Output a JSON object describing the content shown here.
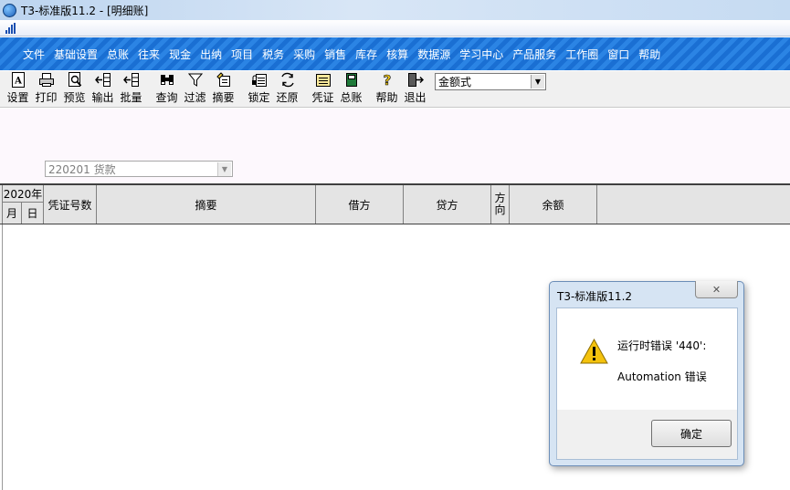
{
  "window": {
    "title": "T3-标准版11.2 - [明细账]"
  },
  "menu": [
    "文件",
    "基础设置",
    "总账",
    "往来",
    "现金",
    "出纳",
    "项目",
    "税务",
    "采购",
    "销售",
    "库存",
    "核算",
    "数据源",
    "学习中心",
    "产品服务",
    "工作圈",
    "窗口",
    "帮助"
  ],
  "toolbar": {
    "buttons": [
      {
        "label": "设置",
        "icon": "settings-icon"
      },
      {
        "label": "打印",
        "icon": "print-icon"
      },
      {
        "label": "预览",
        "icon": "preview-icon"
      },
      {
        "label": "输出",
        "icon": "export-icon"
      },
      {
        "label": "批量",
        "icon": "batch-icon"
      },
      {
        "label": "查询",
        "icon": "binoculars-icon"
      },
      {
        "label": "过滤",
        "icon": "filter-icon"
      },
      {
        "label": "摘要",
        "icon": "summary-icon"
      },
      {
        "label": "锁定",
        "icon": "lock-icon"
      },
      {
        "label": "还原",
        "icon": "restore-icon"
      },
      {
        "label": "凭证",
        "icon": "voucher-icon"
      },
      {
        "label": "总账",
        "icon": "ledger-book-icon"
      },
      {
        "label": "帮助",
        "icon": "help-icon"
      },
      {
        "label": "退出",
        "icon": "exit-icon"
      }
    ],
    "format_select": "金额式"
  },
  "filter": {
    "account": "220201 货款"
  },
  "ledger": {
    "year": "2020年",
    "month": "月",
    "day": "日",
    "columns": {
      "voucher_no": "凭证号数",
      "summary": "摘要",
      "debit": "借方",
      "credit": "贷方",
      "direction": "方\n向",
      "balance": "余额"
    }
  },
  "dialog": {
    "title": "T3-标准版11.2",
    "message_line1": "运行时错误 '440':",
    "message_line2": "Automation 错误",
    "ok_label": "确定"
  }
}
